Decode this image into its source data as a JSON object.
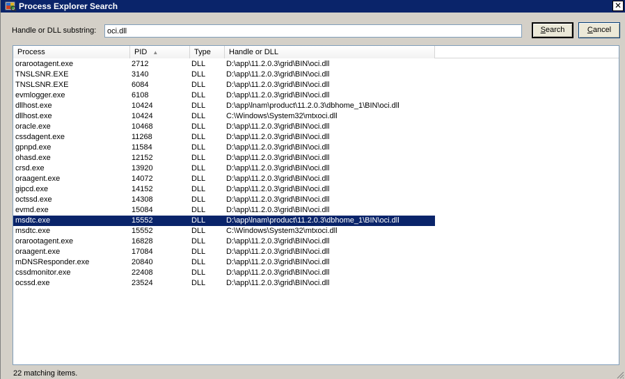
{
  "window": {
    "title": "Process Explorer Search",
    "close_glyph": "✕"
  },
  "search": {
    "label": "Handle or DLL substring:",
    "value": "oci.dll"
  },
  "buttons": {
    "search": {
      "pre": "",
      "accel": "S",
      "post": "earch"
    },
    "cancel": {
      "pre": "",
      "accel": "C",
      "post": "ancel"
    }
  },
  "columns": {
    "process": "Process",
    "pid": "PID",
    "type": "Type",
    "handle": "Handle or DLL"
  },
  "rows": [
    {
      "process": "orarootagent.exe",
      "pid": "2712",
      "type": "DLL",
      "handle": "D:\\app\\11.2.0.3\\grid\\BIN\\oci.dll"
    },
    {
      "process": "TNSLSNR.EXE",
      "pid": "3140",
      "type": "DLL",
      "handle": "D:\\app\\11.2.0.3\\grid\\BIN\\oci.dll"
    },
    {
      "process": "TNSLSNR.EXE",
      "pid": "6084",
      "type": "DLL",
      "handle": "D:\\app\\11.2.0.3\\grid\\BIN\\oci.dll"
    },
    {
      "process": "evmlogger.exe",
      "pid": "6108",
      "type": "DLL",
      "handle": "D:\\app\\11.2.0.3\\grid\\BIN\\oci.dll"
    },
    {
      "process": "dllhost.exe",
      "pid": "10424",
      "type": "DLL",
      "handle": "D:\\app\\lnam\\product\\11.2.0.3\\dbhome_1\\BIN\\oci.dll"
    },
    {
      "process": "dllhost.exe",
      "pid": "10424",
      "type": "DLL",
      "handle": "C:\\Windows\\System32\\mtxoci.dll"
    },
    {
      "process": "oracle.exe",
      "pid": "10468",
      "type": "DLL",
      "handle": "D:\\app\\11.2.0.3\\grid\\BIN\\oci.dll"
    },
    {
      "process": "cssdagent.exe",
      "pid": "11268",
      "type": "DLL",
      "handle": "D:\\app\\11.2.0.3\\grid\\BIN\\oci.dll"
    },
    {
      "process": "gpnpd.exe",
      "pid": "11584",
      "type": "DLL",
      "handle": "D:\\app\\11.2.0.3\\grid\\BIN\\oci.dll"
    },
    {
      "process": "ohasd.exe",
      "pid": "12152",
      "type": "DLL",
      "handle": "D:\\app\\11.2.0.3\\grid\\BIN\\oci.dll"
    },
    {
      "process": "crsd.exe",
      "pid": "13920",
      "type": "DLL",
      "handle": "D:\\app\\11.2.0.3\\grid\\BIN\\oci.dll"
    },
    {
      "process": "oraagent.exe",
      "pid": "14072",
      "type": "DLL",
      "handle": "D:\\app\\11.2.0.3\\grid\\BIN\\oci.dll"
    },
    {
      "process": "gipcd.exe",
      "pid": "14152",
      "type": "DLL",
      "handle": "D:\\app\\11.2.0.3\\grid\\BIN\\oci.dll"
    },
    {
      "process": "octssd.exe",
      "pid": "14308",
      "type": "DLL",
      "handle": "D:\\app\\11.2.0.3\\grid\\BIN\\oci.dll"
    },
    {
      "process": "evmd.exe",
      "pid": "15084",
      "type": "DLL",
      "handle": "D:\\app\\11.2.0.3\\grid\\BIN\\oci.dll"
    },
    {
      "process": "msdtc.exe",
      "pid": "15552",
      "type": "DLL",
      "handle": "D:\\app\\lnam\\product\\11.2.0.3\\dbhome_1\\BIN\\oci.dll",
      "selected": true
    },
    {
      "process": "msdtc.exe",
      "pid": "15552",
      "type": "DLL",
      "handle": "C:\\Windows\\System32\\mtxoci.dll"
    },
    {
      "process": "orarootagent.exe",
      "pid": "16828",
      "type": "DLL",
      "handle": "D:\\app\\11.2.0.3\\grid\\BIN\\oci.dll"
    },
    {
      "process": "oraagent.exe",
      "pid": "17084",
      "type": "DLL",
      "handle": "D:\\app\\11.2.0.3\\grid\\BIN\\oci.dll"
    },
    {
      "process": "mDNSResponder.exe",
      "pid": "20840",
      "type": "DLL",
      "handle": "D:\\app\\11.2.0.3\\grid\\BIN\\oci.dll"
    },
    {
      "process": "cssdmonitor.exe",
      "pid": "22408",
      "type": "DLL",
      "handle": "D:\\app\\11.2.0.3\\grid\\BIN\\oci.dll"
    },
    {
      "process": "ocssd.exe",
      "pid": "23524",
      "type": "DLL",
      "handle": "D:\\app\\11.2.0.3\\grid\\BIN\\oci.dll"
    }
  ],
  "status": {
    "text": "22 matching items."
  },
  "colors": {
    "title_bar": "#0a246a",
    "selection": "#0a246a",
    "dialog": "#d4d0c8"
  },
  "icons": {
    "app": "process-explorer-icon",
    "sort": "sort-ascending-icon",
    "grip": "resize-grip-icon"
  }
}
